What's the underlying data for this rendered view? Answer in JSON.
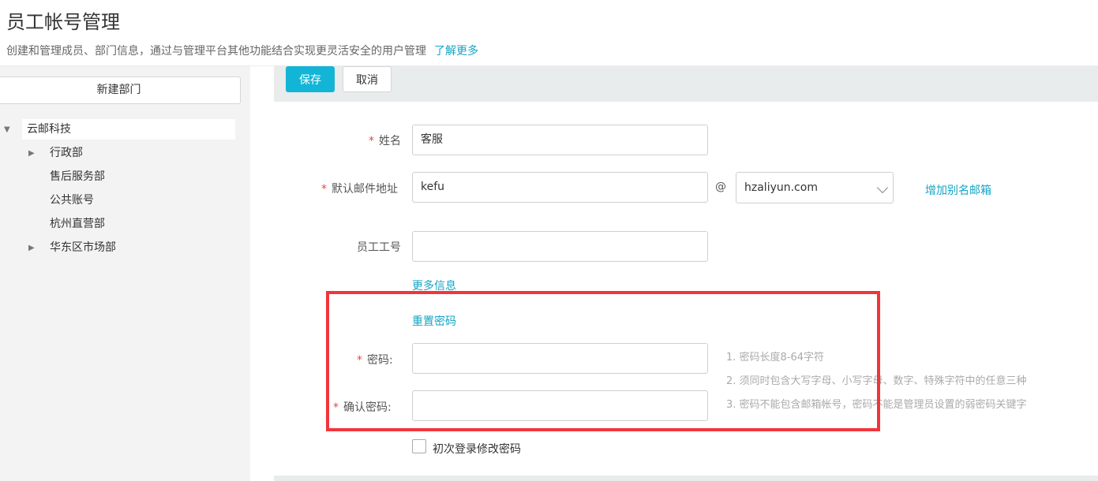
{
  "header": {
    "title": "员工帐号管理",
    "description": "创建和管理成员、部门信息，通过与管理平台其他功能结合实现更灵活安全的用户管理",
    "learn_more": "了解更多"
  },
  "sidebar": {
    "new_dept_label": "新建部门",
    "root": "云邮科技",
    "items": [
      {
        "label": "行政部",
        "expandable": true
      },
      {
        "label": "售后服务部",
        "expandable": false
      },
      {
        "label": "公共账号",
        "expandable": false
      },
      {
        "label": "杭州直营部",
        "expandable": false
      },
      {
        "label": "华东区市场部",
        "expandable": true
      }
    ]
  },
  "toolbar": {
    "save_label": "保存",
    "cancel_label": "取消"
  },
  "form": {
    "required_mark": "*",
    "name_label": "姓名",
    "name_value": "客服",
    "email_label": "默认邮件地址",
    "email_value": "kefu",
    "at_sign": "@",
    "domain_value": "hzaliyun.com",
    "add_alias": "增加别名邮箱",
    "employee_id_label": "员工工号",
    "employee_id_value": "",
    "more_info": "更多信息",
    "reset_password": "重置密码",
    "password_label": "密码:",
    "password_value": "",
    "confirm_password_label": "确认密码:",
    "confirm_password_value": "",
    "password_hints": [
      "1. 密码长度8-64字符",
      "2. 须同时包含大写字母、小写字母、数字、特殊字符中的任意三种",
      "3. 密码不能包含邮箱帐号，密码不能是管理员设置的弱密码关键字"
    ],
    "first_login_label": "初次登录修改密码",
    "first_login_checked": false
  },
  "colors": {
    "accent": "#13b5d6",
    "link": "#13a4c6",
    "required": "#e94545",
    "highlight": "#f2353a"
  }
}
